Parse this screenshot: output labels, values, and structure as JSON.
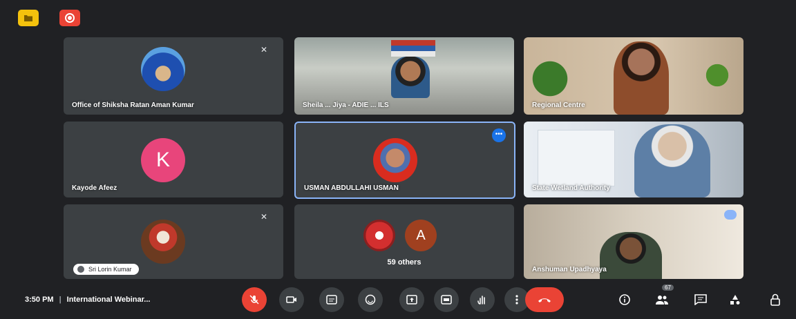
{
  "meeting": {
    "time": "3:50 PM",
    "title": "International Webinar..."
  },
  "participants": [
    {
      "name": "Office of Shiksha Ratan Aman Kumar"
    },
    {
      "name": "Sheila ... Jiya - ADIE ... ILS"
    },
    {
      "name": "Regional Centre"
    },
    {
      "name": "Kayode Afeez",
      "initial": "K"
    },
    {
      "name": "USMAN ABDULLAHI USMAN"
    },
    {
      "name": "State Wetland Authority"
    },
    {
      "name": "Sri Lorin Kumar"
    },
    {
      "name": "Anshuman Upadhyaya"
    }
  ],
  "others": {
    "initial": "A",
    "label": "59 others"
  },
  "people_count": "67",
  "colors": {
    "background": "#202124",
    "tile": "#3c4043",
    "red": "#ea4335",
    "yellow": "#f4c20d",
    "blue": "#1a73e8",
    "pink_avatar": "#e8457b",
    "orange_avatar": "#a0401f"
  }
}
